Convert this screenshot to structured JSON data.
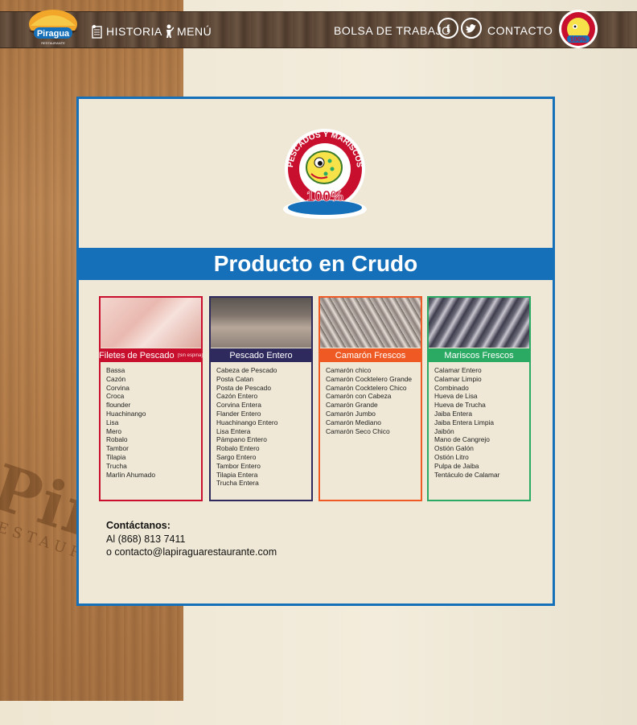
{
  "brand": {
    "name": "Piragua",
    "sub": "RESTAURANTE"
  },
  "nav": {
    "historia": "HISTORIA",
    "menu": "MENÚ",
    "bolsa": "BOLSA DE TRABAJO",
    "contacto": "CONTACTO"
  },
  "social": {
    "facebook": "f",
    "twitter": "t"
  },
  "badge": {
    "top": "PESCADOS Y MARISCOS",
    "pct": "100%"
  },
  "page_title": "Producto en Crudo",
  "columns": [
    {
      "title": "Filetes de Pescado",
      "note": "[Sin espina]",
      "color": "#c8102e",
      "items": [
        "Bassa",
        "Cazón",
        "Corvina",
        "Croca",
        "flounder",
        "Huachinango",
        "Lisa",
        "Mero",
        "Robalo",
        "Tambor",
        "Tilapia",
        "Trucha",
        "Marlín Ahumado"
      ]
    },
    {
      "title": "Pescado Entero",
      "note": "",
      "color": "#2e2a5e",
      "items": [
        "Cabeza de Pescado",
        "Posta Catan",
        "Posta  de Pescado",
        "Cazón Entero",
        "Corvina Entera",
        "Flander  Entero",
        "Huachinango Entero",
        "Lisa Entera",
        "Pámpano Entero",
        "Robalo Entero",
        "Sargo Entero",
        "Tambor Entero",
        "Tilapia Entera",
        "Trucha Entera"
      ]
    },
    {
      "title": "Camarón Frescos",
      "note": "",
      "color": "#ef5a24",
      "items": [
        "Camarón chico",
        "Camarón Cocktelero Grande",
        "Camarón Cocktelero Chico",
        "Camarón con Cabeza",
        "Camarón Grande",
        "Camarón Jumbo",
        "Camarón Mediano",
        "Camarón Seco Chico"
      ]
    },
    {
      "title": "Mariscos Frescos",
      "note": "",
      "color": "#2aaa63",
      "items": [
        "Calamar Entero",
        "Calamar Limpio",
        "Combinado",
        "Hueva de Lisa",
        "Hueva de Trucha",
        "Jaiba Entera",
        "Jaiba Entera Limpia",
        "Jaibón",
        "Mano de Cangrejo",
        "Ostión Galón",
        "Ostión Litro",
        "Pulpa de Jaiba",
        "Tentáculo de Calamar"
      ]
    }
  ],
  "contact": {
    "label": "Contáctanos:",
    "phone": "Al (868) 813 7411",
    "email": "o contacto@lapiraguarestaurante.com"
  }
}
